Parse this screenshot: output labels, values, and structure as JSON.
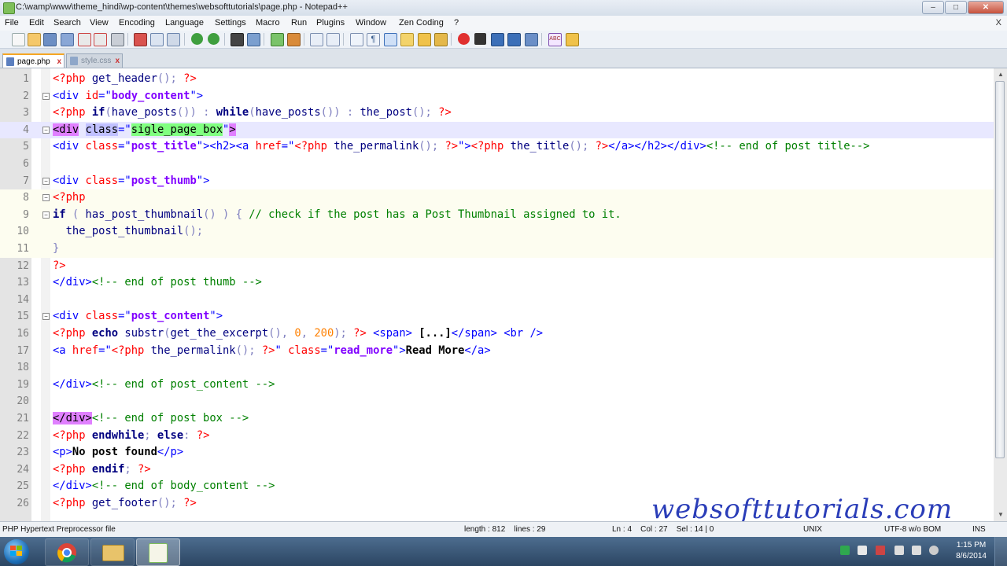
{
  "window": {
    "title": "C:\\wamp\\www\\theme_hindi\\wp-content\\themes\\websofttutorials\\page.php - Notepad++",
    "buttons": [
      "minimize",
      "maximize",
      "close"
    ]
  },
  "menu": [
    "File",
    "Edit",
    "Search",
    "View",
    "Encoding",
    "Language",
    "Settings",
    "Macro",
    "Run",
    "Plugins",
    "Window",
    "Zen Coding",
    "?"
  ],
  "menu_close": "X",
  "tabs": [
    {
      "label": "page.php",
      "active": true
    },
    {
      "label": "style.css",
      "active": false
    }
  ],
  "tab_close": "x",
  "editor": {
    "line_numbers": [
      "1",
      "2",
      "3",
      "4",
      "5",
      "6",
      "7",
      "8",
      "9",
      "10",
      "11",
      "12",
      "13",
      "14",
      "15",
      "16",
      "17",
      "18",
      "19",
      "20",
      "21",
      "22",
      "23",
      "24",
      "25",
      "26"
    ],
    "fold_markers": {
      "2": "−",
      "4": "−",
      "7": "−",
      "8": "−",
      "9": "−",
      "15": "−"
    },
    "lines": [
      [
        [
          "php",
          "<?php "
        ],
        [
          "fn",
          "get_header"
        ],
        [
          "op",
          "(); "
        ],
        [
          "php",
          "?>"
        ]
      ],
      [
        [
          "tag",
          "<div "
        ],
        [
          "attr",
          "id"
        ],
        [
          "tag",
          "="
        ],
        [
          "tag",
          "\""
        ],
        [
          "val",
          "body_content"
        ],
        [
          "tag",
          "\">"
        ]
      ],
      [
        [
          "php",
          "<?php "
        ],
        [
          "kw",
          "if"
        ],
        [
          "op",
          "("
        ],
        [
          "fn",
          "have_posts"
        ],
        [
          "op",
          "()) : "
        ],
        [
          "kw",
          "while"
        ],
        [
          "op",
          "("
        ],
        [
          "fn",
          "have_posts"
        ],
        [
          "op",
          "()) : "
        ],
        [
          "fn",
          "the_post"
        ],
        [
          "op",
          "(); "
        ],
        [
          "php",
          "?>"
        ]
      ],
      [
        [
          "brace",
          "<div"
        ],
        [
          "tag",
          " "
        ],
        [
          "sel",
          "class"
        ],
        [
          "tag",
          "=\""
        ],
        [
          "match",
          "sigle_page_box"
        ],
        [
          "tag",
          "\""
        ],
        [
          "brace",
          ">"
        ]
      ],
      [
        [
          "tag",
          "<div "
        ],
        [
          "attr",
          "class"
        ],
        [
          "tag",
          "=\""
        ],
        [
          "val",
          "post_title"
        ],
        [
          "tag",
          "\"><h2><a "
        ],
        [
          "attr",
          "href"
        ],
        [
          "tag",
          "=\""
        ],
        [
          "php",
          "<?php "
        ],
        [
          "fn",
          "the_permalink"
        ],
        [
          "op",
          "(); "
        ],
        [
          "php",
          "?>"
        ],
        [
          "tag",
          "\">"
        ],
        [
          "php",
          "<?php "
        ],
        [
          "fn",
          "the_title"
        ],
        [
          "op",
          "(); "
        ],
        [
          "php",
          "?>"
        ],
        [
          "tag",
          "</a></h2></div>"
        ],
        [
          "com",
          "<!-- end of post title-->"
        ]
      ],
      [],
      [
        [
          "tag",
          "<div "
        ],
        [
          "attr",
          "class"
        ],
        [
          "tag",
          "=\""
        ],
        [
          "val",
          "post_thumb"
        ],
        [
          "tag",
          "\">"
        ]
      ],
      [
        [
          "php",
          "<?php"
        ]
      ],
      [
        [
          "kw",
          "if"
        ],
        [
          "op",
          " ( "
        ],
        [
          "fn",
          "has_post_thumbnail"
        ],
        [
          "op",
          "() ) { "
        ],
        [
          "com",
          "// check if the post has a Post Thumbnail assigned to it."
        ]
      ],
      [
        [
          "fn",
          "  the_post_thumbnail"
        ],
        [
          "op",
          "();"
        ]
      ],
      [
        [
          "op",
          "}"
        ]
      ],
      [
        [
          "php",
          "?>"
        ]
      ],
      [
        [
          "tag",
          "</div>"
        ],
        [
          "com",
          "<!-- end of post thumb -->"
        ]
      ],
      [],
      [
        [
          "tag",
          "<div "
        ],
        [
          "attr",
          "class"
        ],
        [
          "tag",
          "=\""
        ],
        [
          "val",
          "post_content"
        ],
        [
          "tag",
          "\">"
        ]
      ],
      [
        [
          "php",
          "<?php "
        ],
        [
          "kw",
          "echo "
        ],
        [
          "fn",
          "substr"
        ],
        [
          "op",
          "("
        ],
        [
          "fn",
          "get_the_excerpt"
        ],
        [
          "op",
          "(), "
        ],
        [
          "num",
          "0"
        ],
        [
          "op",
          ", "
        ],
        [
          "num",
          "200"
        ],
        [
          "op",
          "); "
        ],
        [
          "php",
          "?>"
        ],
        [
          "tag",
          " <span> "
        ],
        [
          "txt",
          "[...]"
        ],
        [
          "tag",
          "</span> <br />"
        ]
      ],
      [
        [
          "tag",
          "<a "
        ],
        [
          "attr",
          "href"
        ],
        [
          "tag",
          "=\""
        ],
        [
          "php",
          "<?php "
        ],
        [
          "fn",
          "the_permalink"
        ],
        [
          "op",
          "(); "
        ],
        [
          "php",
          "?>"
        ],
        [
          "tag",
          "\" "
        ],
        [
          "attr",
          "class"
        ],
        [
          "tag",
          "=\""
        ],
        [
          "val",
          "read_more"
        ],
        [
          "tag",
          "\">"
        ],
        [
          "txt",
          "Read More"
        ],
        [
          "tag",
          "</a>"
        ]
      ],
      [],
      [
        [
          "tag",
          "</div>"
        ],
        [
          "com",
          "<!-- end of post_content -->"
        ]
      ],
      [],
      [
        [
          "brace",
          "</div>"
        ],
        [
          "com",
          "<!-- end of post box -->"
        ]
      ],
      [
        [
          "php",
          "<?php "
        ],
        [
          "kw",
          "endwhile"
        ],
        [
          "op",
          "; "
        ],
        [
          "kw",
          "else"
        ],
        [
          "op",
          ": "
        ],
        [
          "php",
          "?>"
        ]
      ],
      [
        [
          "tag",
          "<p>"
        ],
        [
          "txt",
          "No post found"
        ],
        [
          "tag",
          "</p>"
        ]
      ],
      [
        [
          "php",
          "<?php "
        ],
        [
          "kw",
          "endif"
        ],
        [
          "op",
          "; "
        ],
        [
          "php",
          "?>"
        ]
      ],
      [
        [
          "tag",
          "</div>"
        ],
        [
          "com",
          "<!-- end of body_content -->"
        ]
      ],
      [
        [
          "php",
          "<?php "
        ],
        [
          "fn",
          "get_footer"
        ],
        [
          "op",
          "(); "
        ],
        [
          "php",
          "?>"
        ]
      ]
    ]
  },
  "status": {
    "file_type": "PHP Hypertext Preprocessor file",
    "length_lines": "length : 812    lines : 29",
    "position": "Ln : 4    Col : 27    Sel : 14 | 0",
    "eol": "UNIX",
    "encoding": "UTF-8 w/o BOM",
    "mode": "INS"
  },
  "watermark": "websofttutorials.com",
  "taskbar": {
    "time": "1:15 PM",
    "date": "8/6/2014"
  },
  "colors": {
    "php_delim": "#ff0000",
    "keyword": "#000080",
    "html_tag": "#0000ff",
    "attr_value": "#8000ff",
    "comment": "#008000",
    "current_line": "#e8e8ff",
    "watermark": "#2a3db8"
  }
}
